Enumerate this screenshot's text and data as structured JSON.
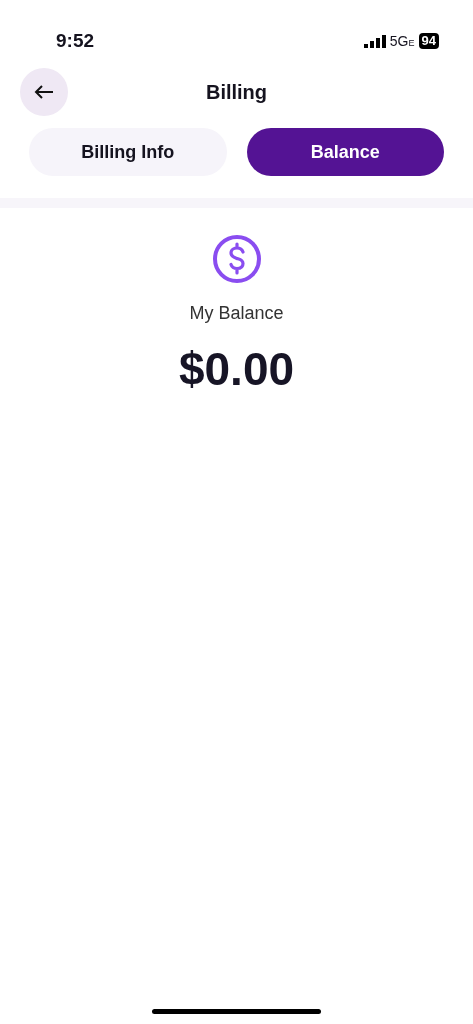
{
  "status_bar": {
    "time": "9:52",
    "network": "5G",
    "network_suffix": "E",
    "battery": "94"
  },
  "header": {
    "title": "Billing"
  },
  "tabs": [
    {
      "label": "Billing Info",
      "selected": false
    },
    {
      "label": "Balance",
      "selected": true
    }
  ],
  "balance": {
    "label": "My Balance",
    "amount": "$0.00"
  }
}
